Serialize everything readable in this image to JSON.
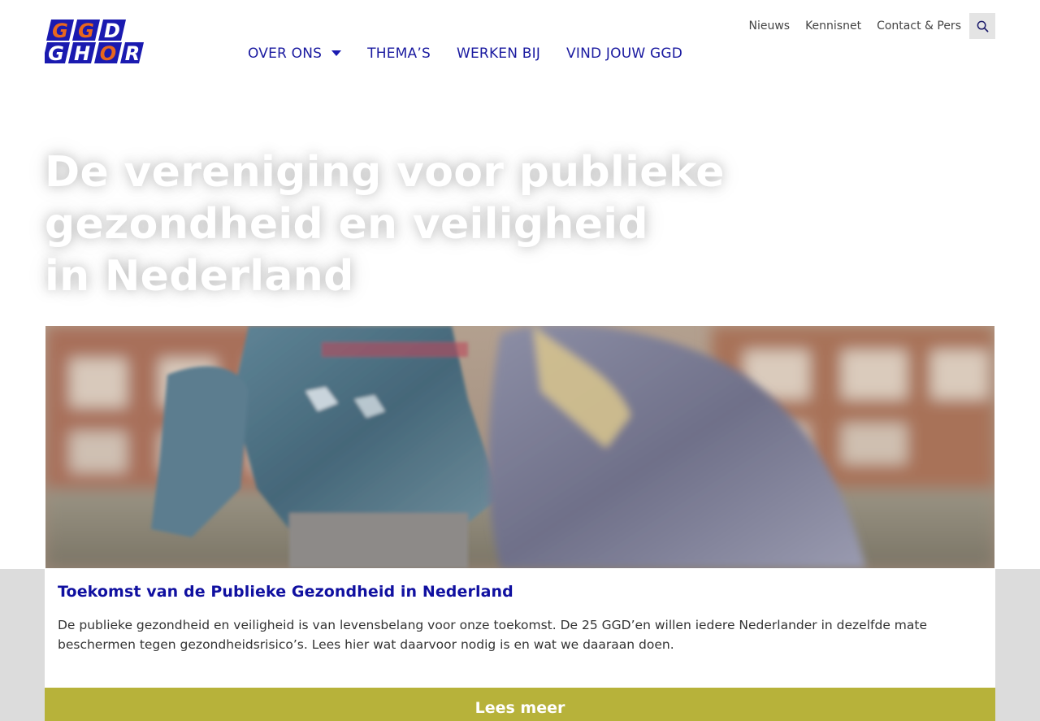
{
  "brand": {
    "logo_alt": "GGD GHOR",
    "logo_letters": [
      "G",
      "G",
      "D",
      "G",
      "H",
      "O",
      "R"
    ],
    "colors": {
      "blue": "#1a1ab0",
      "orange": "#e8671e",
      "olive": "#b7b23a"
    }
  },
  "top_links": [
    "Nieuws",
    "Kennisnet",
    "Contact & Pers"
  ],
  "search": {
    "icon": "search-icon"
  },
  "main_nav": [
    {
      "label": "OVER ONS",
      "has_dropdown": true
    },
    {
      "label": "THEMA’S",
      "has_dropdown": false
    },
    {
      "label": "WERKEN BIJ",
      "has_dropdown": false
    },
    {
      "label": "VIND JOUW GGD",
      "has_dropdown": false
    }
  ],
  "hero": {
    "title_lines": [
      "De vereniging voor publieke",
      "gezondheid en veiligheid",
      "in Nederland"
    ]
  },
  "card": {
    "title": "Toekomst van de Publieke Gezondheid in Nederland",
    "text": "De publieke gezondheid en veiligheid is van levensbelang voor onze toekomst. De 25 GGD’en willen iedere Nederlander in dezelfde mate beschermen tegen gezondheidsrisico’s. Lees hier wat daarvoor nodig is en wat we daaraan doen.",
    "cta": "Lees meer"
  }
}
